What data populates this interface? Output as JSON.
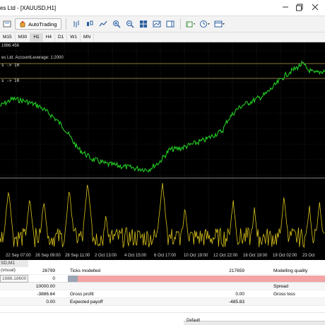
{
  "window": {
    "title": "es Ltd - [XAUUSD,H1]"
  },
  "toolbar": {
    "autotrading_label": "AutoTrading",
    "icons": [
      "chart-bars-icon",
      "chart-candles-icon",
      "chart-line-icon",
      "zoom-in-icon",
      "zoom-out-icon",
      "tile-windows-icon",
      "scroll-chart-icon",
      "shift-chart-icon",
      "indicators-icon",
      "periods-icon",
      "templates-icon"
    ]
  },
  "timeframes": [
    "M15",
    "M30",
    "H1",
    "H4",
    "D1",
    "W1",
    "MN"
  ],
  "timeframe_active": "H1",
  "chart": {
    "info_line1": "1986.456",
    "info_line2": "es Ltd. AccountLeverage: 1:2000",
    "label_a": "s -> 10",
    "label_b": "s -> 10",
    "xaxis_labels": [
      "22 Sep 07:00",
      "26 Sep 09:00",
      "28 Sep 11:00",
      "2 Oct 13:00",
      "4 Oct 15:00",
      "6 Oct 17:00",
      "10 Oct 19:00",
      "12 Oct 22:00",
      "16 Oct 19:00",
      "19 Oct 02:00",
      "23 Oct"
    ],
    "colors": {
      "background": "#000000",
      "price_line": "#22cc22",
      "indicator_line": "#d8c21a",
      "grid": "#3a3a3a",
      "level_line": "#b8a14a"
    }
  },
  "tester": {
    "tab_label": "SD,M1 (visual)",
    "price_input": "1986.18600",
    "rows": [
      {
        "v1": "26799",
        "label": "Ticks modelled",
        "v2": "217659",
        "label2": "Modelling quality"
      },
      {
        "v1": "0",
        "label": "",
        "v2": "",
        "label2": ""
      },
      {
        "v1": "10000.00",
        "label": "",
        "v2": "",
        "label2": "Spread"
      },
      {
        "v1": "-3886.64",
        "label": "Gross profit",
        "v2": "0.00",
        "label2": "Gross loss"
      },
      {
        "v1": "0.00",
        "label": "Expected payoff",
        "v2": "-485.83",
        "label2": ""
      }
    ],
    "bottom_label": "Default"
  }
}
